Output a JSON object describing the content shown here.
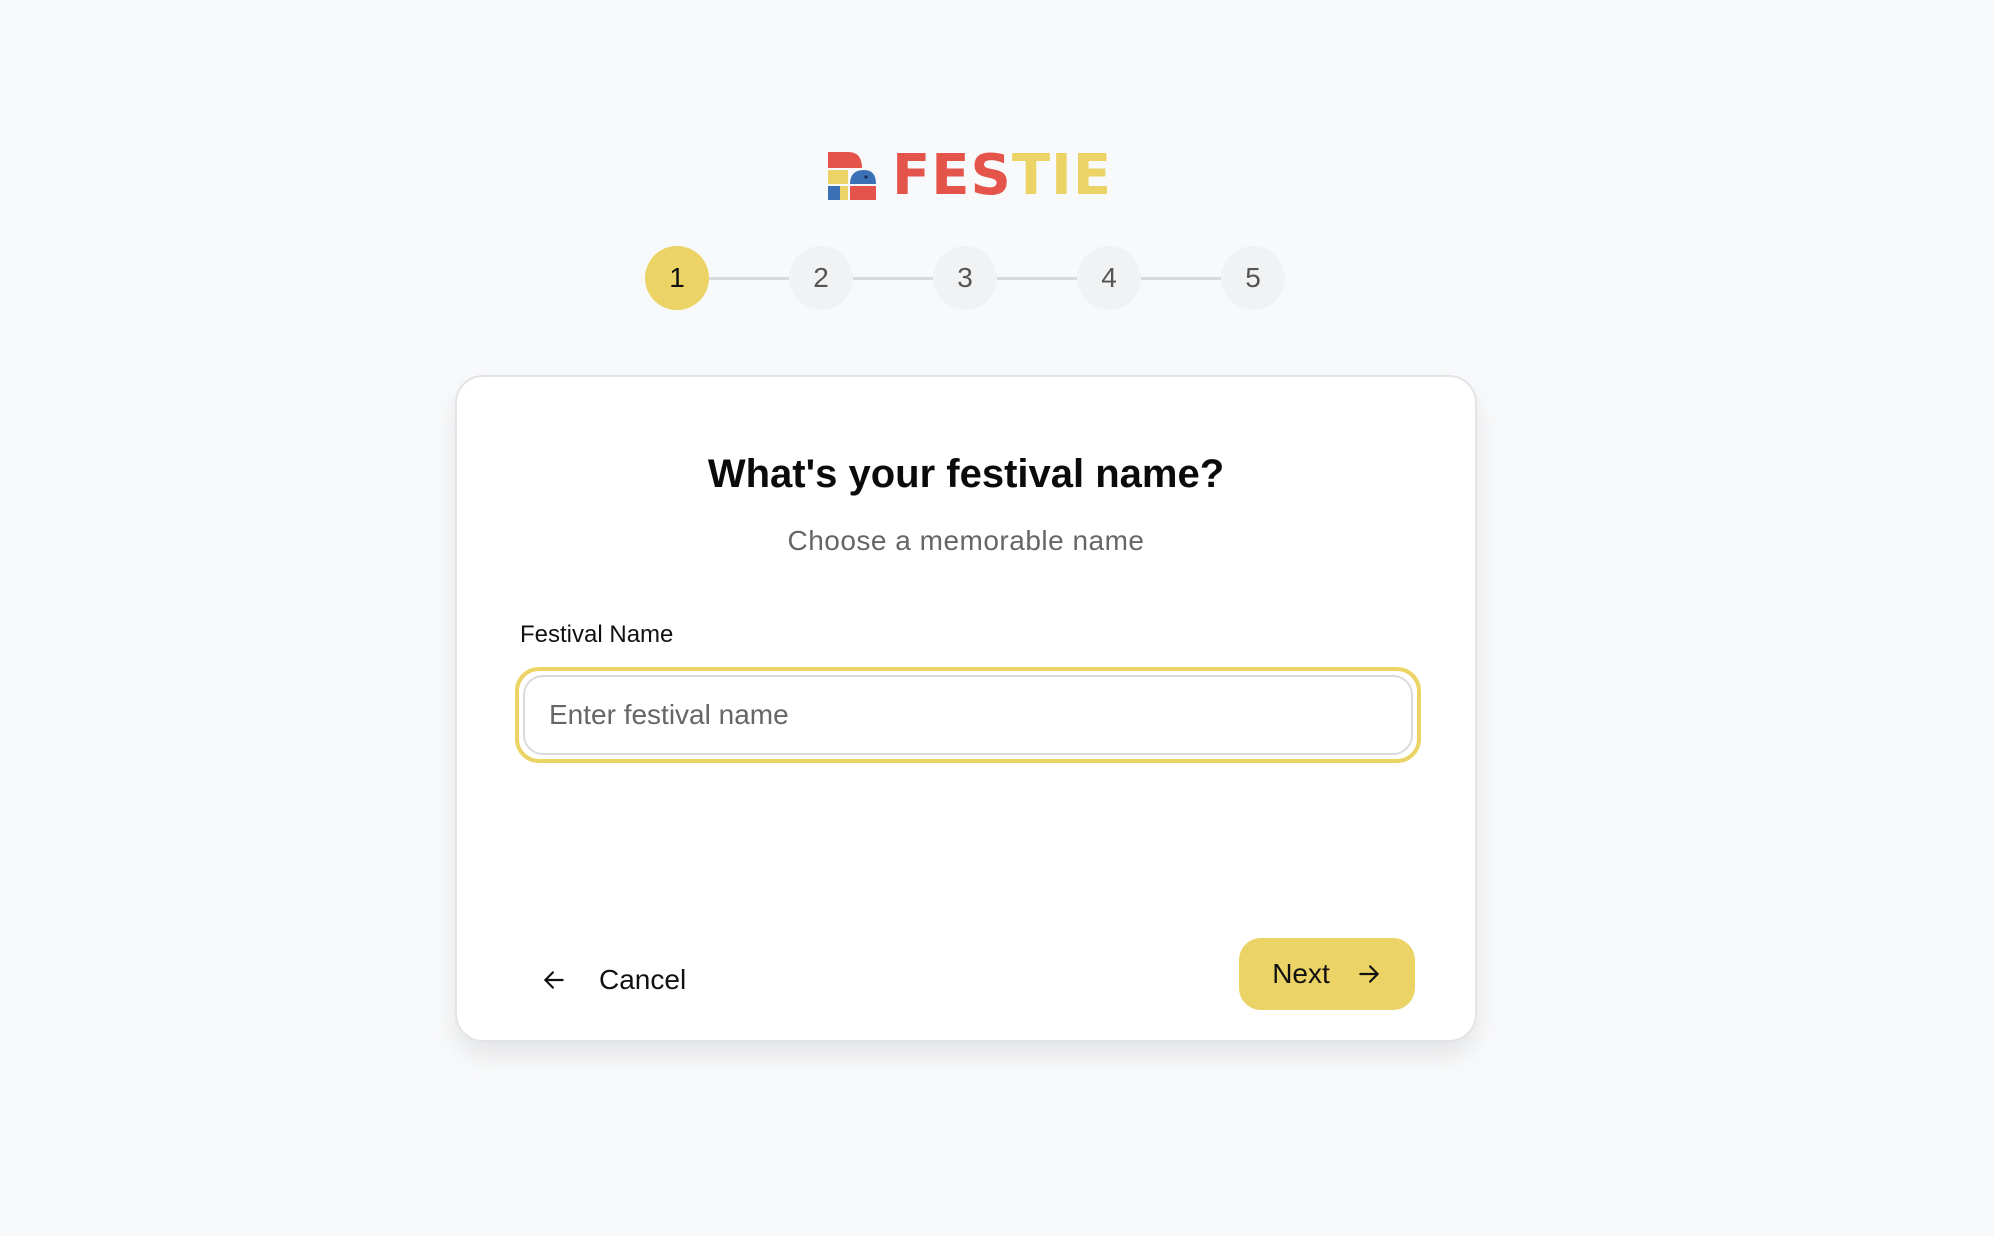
{
  "brand": {
    "name_part1": "FES",
    "name_part2": "TIE",
    "color_red": "#e4544a",
    "color_yellow": "#ecd365",
    "color_blue": "#3b6fb6"
  },
  "stepper": {
    "steps": [
      "1",
      "2",
      "3",
      "4",
      "5"
    ],
    "active_step": 1
  },
  "card": {
    "title": "What's your festival name?",
    "subtitle": "Choose a memorable name",
    "field_label": "Festival Name",
    "input_value": "",
    "input_placeholder": "Enter festival name",
    "cancel_label": "Cancel",
    "next_label": "Next"
  },
  "colors": {
    "accent": "#ecd365",
    "background": "#f8f9fa"
  },
  "icons": {
    "cancel": "arrow-left-icon",
    "next": "arrow-right-icon"
  }
}
